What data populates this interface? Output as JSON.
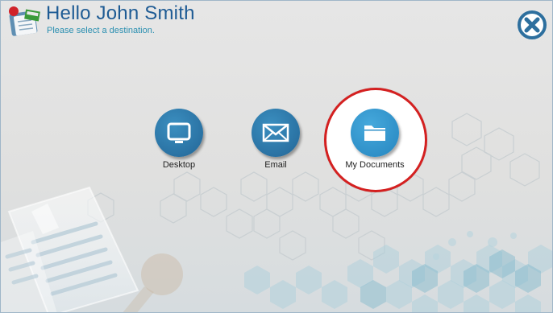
{
  "header": {
    "greeting": "Hello John Smith",
    "subtitle": "Please select a destination.",
    "logo_icon": "scan-document-icon"
  },
  "close_button": {
    "icon": "close-circle-icon"
  },
  "destinations": [
    {
      "label": "Desktop",
      "icon": "monitor-icon"
    },
    {
      "label": "Email",
      "icon": "envelope-icon"
    },
    {
      "label": "My Documents",
      "icon": "folder-icon",
      "highlighted": true
    }
  ],
  "colors": {
    "title": "#1e5b94",
    "subtitle": "#2a8fb0",
    "button": "#2a72a3",
    "button_highlight": "#2f90c8",
    "highlight_ring": "#d42020",
    "close": "#2d6f9e"
  }
}
